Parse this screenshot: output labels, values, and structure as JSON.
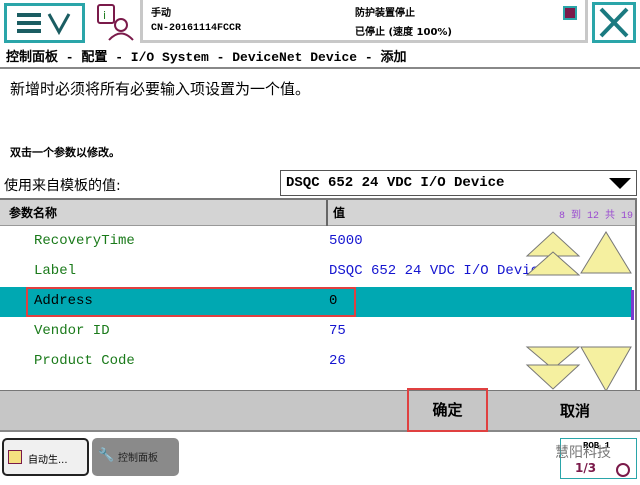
{
  "header": {
    "mode": "手动",
    "controller": "CN-20161114FCCR",
    "safety": "防护装置停止",
    "state": "已停止 (速度 100%)"
  },
  "breadcrumb": "控制面板 - 配置 - I/O System - DeviceNet Device - 添加",
  "message": "新增时必须将所有必要输入项设置为一个值。",
  "hint": "双击一个参数以修改。",
  "template": {
    "label": "使用来自模板的值:",
    "value": "DSQC 652 24 VDC I/O Device"
  },
  "table": {
    "col_name": "参数名称",
    "col_value": "值",
    "paging": "8 到 12 共 19",
    "rows": [
      {
        "name": "RecoveryTime",
        "value": "5000"
      },
      {
        "name": "Label",
        "value": "DSQC 652 24 VDC I/O Device"
      },
      {
        "name": "Address",
        "value": "0"
      },
      {
        "name": "Vendor ID",
        "value": "75"
      },
      {
        "name": "Product Code",
        "value": "26"
      }
    ]
  },
  "buttons": {
    "ok": "确定",
    "cancel": "取消"
  },
  "taskbar": {
    "tab1": "自动生...",
    "tab2": "控制面板",
    "rob": "ROB_1",
    "speed": "1/3",
    "watermark": "慧阳科技"
  }
}
